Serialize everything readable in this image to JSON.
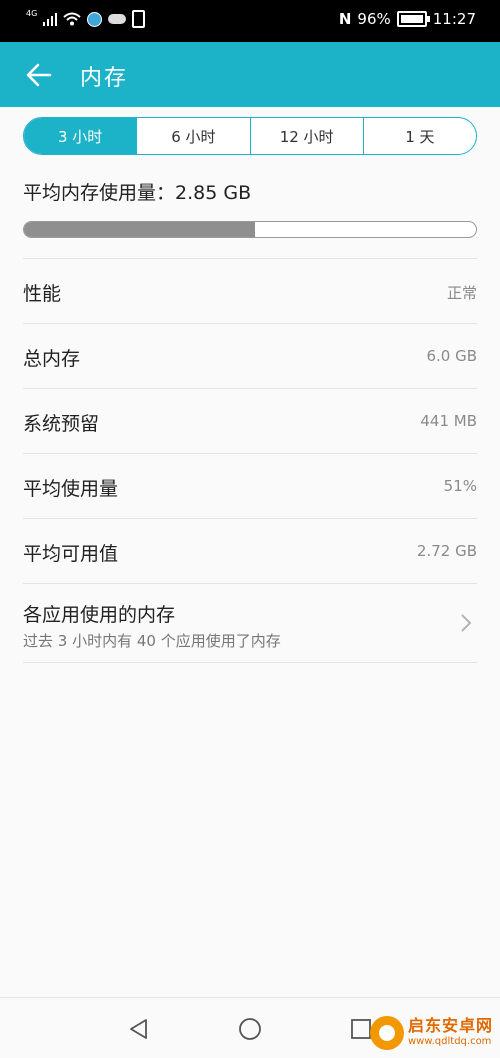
{
  "status_bar": {
    "network": "4G",
    "nfc": "N",
    "battery": "96%",
    "time": "11:27"
  },
  "app_bar": {
    "title": "内存"
  },
  "time_range": {
    "options": [
      "3 小时",
      "6 小时",
      "12 小时",
      "1 天"
    ],
    "selected": "3 小时"
  },
  "summary": {
    "avg_label": "平均内存使用量：2.85 GB",
    "usage_fraction": 0.51
  },
  "rows": [
    {
      "label": "性能",
      "value": "正常"
    },
    {
      "label": "总内存",
      "value": "6.0 GB"
    },
    {
      "label": "系统预留",
      "value": "441 MB"
    },
    {
      "label": "平均使用量",
      "value": "51%"
    },
    {
      "label": "平均可用值",
      "value": "2.72 GB"
    }
  ],
  "apps_row": {
    "title": "各应用使用的内存",
    "subtitle": "过去 3 小时内有 40 个应用使用了内存"
  },
  "watermark": {
    "name": "启东安卓网",
    "url": "www.qdltdq.com"
  },
  "colors": {
    "accent": "#1cb2c8",
    "progress_fill": "#8f8f8f",
    "watermark": "#e06a00"
  },
  "icons": {
    "back": "arrow-left-icon",
    "chevron": "chevron-right-icon",
    "nav_back": "triangle-back-icon",
    "nav_home": "circle-home-icon",
    "nav_recent": "square-recent-icon"
  }
}
